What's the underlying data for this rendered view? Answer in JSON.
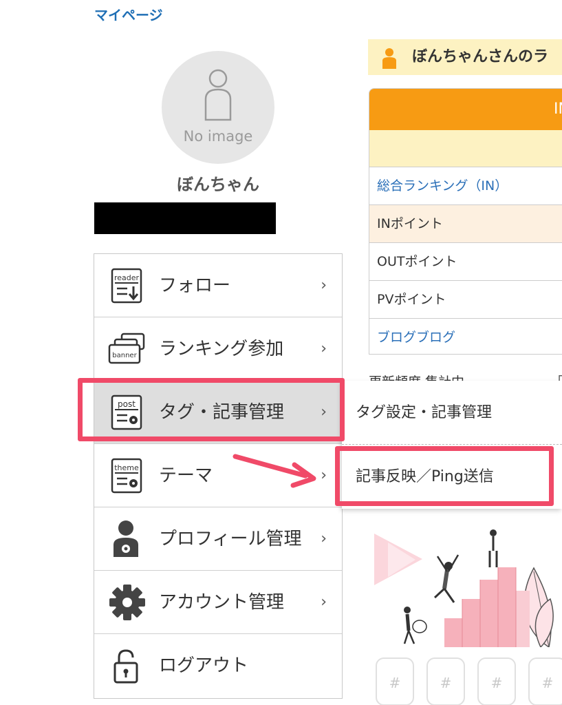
{
  "page": {
    "title": "マイページ"
  },
  "profile": {
    "avatar_text": "No image",
    "name": "ぼんちゃん"
  },
  "menu": {
    "items": [
      {
        "label": "フォロー",
        "icon": "reader-icon",
        "icon_text": "reader"
      },
      {
        "label": "ランキング参加",
        "icon": "banner-icon",
        "icon_text": "banner"
      },
      {
        "label": "タグ・記事管理",
        "icon": "post-icon",
        "icon_text": "post"
      },
      {
        "label": "テーマ",
        "icon": "theme-icon",
        "icon_text": "theme"
      },
      {
        "label": "プロフィール管理",
        "icon": "profile-icon"
      },
      {
        "label": "アカウント管理",
        "icon": "gear-icon"
      },
      {
        "label": "ログアウト",
        "icon": "lock-icon"
      }
    ],
    "chevron": "›"
  },
  "ranking": {
    "header": "ぼんちゃんさんのラ",
    "top_label": "IN",
    "rows": [
      "総合ランキング（IN）",
      "INポイント",
      "OUTポイント",
      "PVポイント",
      "ブログブログ"
    ]
  },
  "cut_text": {
    "left": "更新頻度 集計中",
    "right": "「"
  },
  "submenu": {
    "items": [
      "タグ設定・記事管理",
      "記事反映／Ping送信"
    ]
  },
  "tags": [
    "#",
    "#",
    "#",
    "#"
  ],
  "colors": {
    "accent": "#f04a68",
    "orange": "#f79b13",
    "link": "#2a6fb8",
    "pale_yellow": "#fdf2c2"
  }
}
